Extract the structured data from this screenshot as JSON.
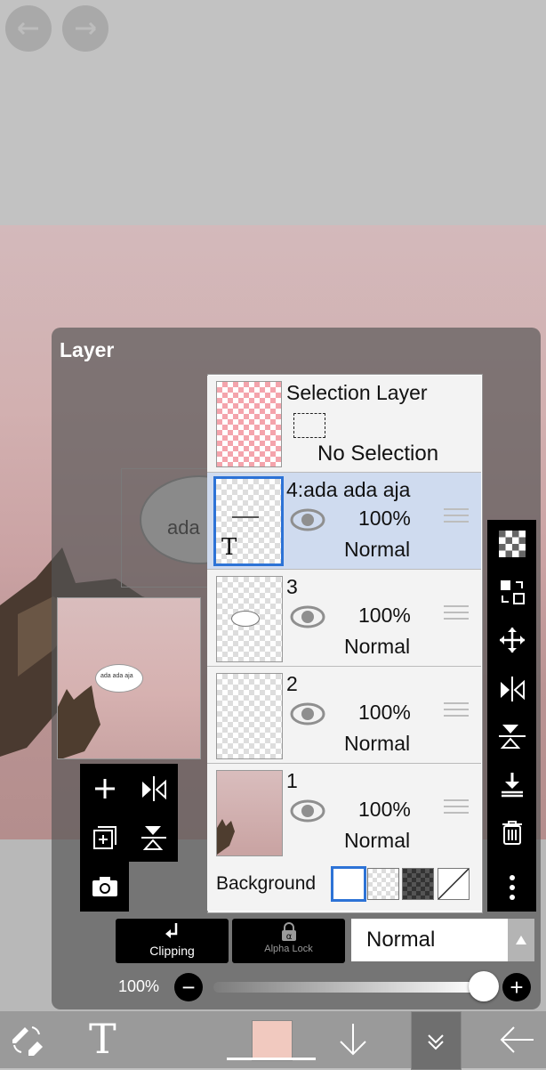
{
  "panel": {
    "title": "Layer"
  },
  "canvas": {
    "bubble_text": "ada",
    "preview_bubble_text": "ada ada aja"
  },
  "layers": [
    {
      "type": "selection",
      "name": "Selection Layer",
      "status": "No Selection"
    },
    {
      "name": "4:ada ada aja",
      "opacity": "100%",
      "blend": "Normal",
      "active": true,
      "text_layer_glyph": "T"
    },
    {
      "name": "3",
      "opacity": "100%",
      "blend": "Normal",
      "active": false
    },
    {
      "name": "2",
      "opacity": "100%",
      "blend": "Normal",
      "active": false
    },
    {
      "name": "1",
      "opacity": "100%",
      "blend": "Normal",
      "active": false
    }
  ],
  "background": {
    "label": "Background"
  },
  "blend_controls": {
    "clipping_label": "Clipping",
    "alpha_lock_label": "Alpha Lock",
    "blend_mode": "Normal"
  },
  "opacity_slider": {
    "label": "100%",
    "value": 1.0
  },
  "toolbar": {
    "text_tool_glyph": "T",
    "current_color": "#f1c9bf"
  },
  "colors": {
    "accent": "#2d73d6",
    "selected_row": "#cfdbef",
    "selection_checker": "#f4a4ac"
  }
}
